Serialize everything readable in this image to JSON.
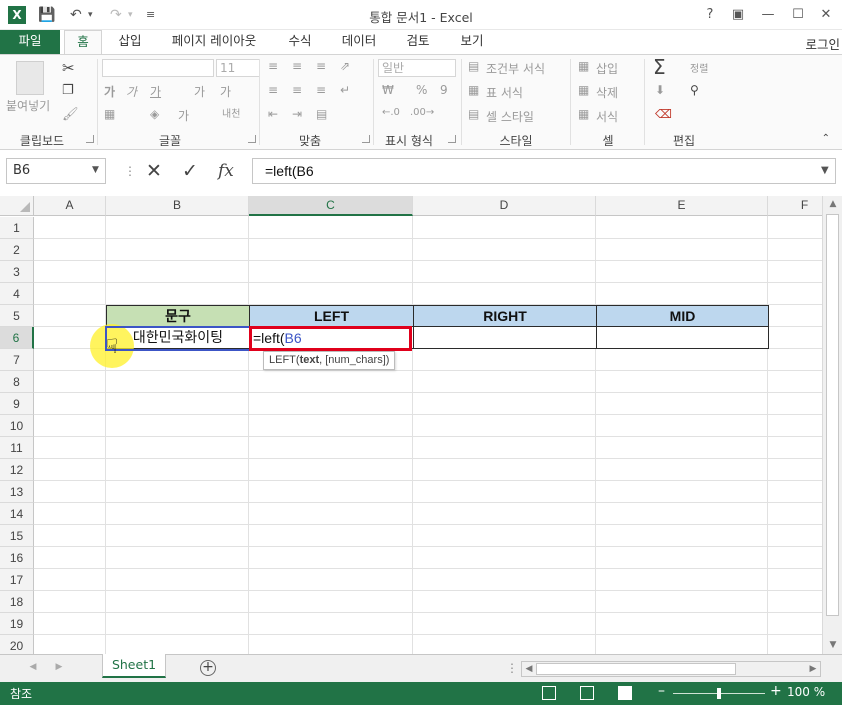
{
  "app": {
    "title": "통합 문서1 - Excel",
    "logo_letter": "X",
    "quick_access": {
      "save_icon": "save-icon",
      "undo_icon": "undo-icon",
      "redo_icon": "redo-icon",
      "customize_icon": "customize-qat-icon"
    },
    "window_buttons": [
      "help",
      "ribbon-display",
      "minimize",
      "maximize",
      "close"
    ]
  },
  "tabs": [
    {
      "label": "파일",
      "kind": "file"
    },
    {
      "label": "홈",
      "kind": "active"
    },
    {
      "label": "삽입"
    },
    {
      "label": "페이지 레이아웃"
    },
    {
      "label": "수식"
    },
    {
      "label": "데이터"
    },
    {
      "label": "검토"
    },
    {
      "label": "보기"
    }
  ],
  "account": {
    "label": "로그인"
  },
  "ribbon": {
    "groups": {
      "clipboard": {
        "label": "클립보드",
        "paste": "붙여넣기"
      },
      "font": {
        "label": "글꼴",
        "font_size": "11",
        "bold": "가",
        "italic": "가",
        "underline": "가",
        "grow": "가",
        "shrink": "가",
        "phonetic": "내천"
      },
      "alignment": {
        "label": "맞춤"
      },
      "number": {
        "label": "표시 형식",
        "format": "일반",
        "currency": "₩",
        "percent": "%",
        "comma": "9"
      },
      "styles": {
        "label": "스타일",
        "conditional": "조건부 서식",
        "table": "표 서식",
        "cell": "셀 스타일"
      },
      "cells": {
        "label": "셀",
        "insert": "삽입",
        "delete": "삭제",
        "format": "서식"
      },
      "editing": {
        "label": "편집",
        "sort": "정렬"
      }
    }
  },
  "formula_bar": {
    "name_box": "B6",
    "cancel_icon": "cancel-icon",
    "enter_icon": "checkmark-icon",
    "fx_label": "fx",
    "formula": "=left(B6"
  },
  "grid": {
    "columns": [
      "A",
      "B",
      "C",
      "D",
      "E",
      "F"
    ],
    "rows": [
      "1",
      "2",
      "3",
      "4",
      "5",
      "6",
      "7",
      "8",
      "9",
      "10",
      "11",
      "12",
      "13",
      "14",
      "15",
      "16",
      "17",
      "18",
      "19",
      "20"
    ],
    "selected_column": "C",
    "selected_row": "6",
    "header_cells": {
      "B5": "문구",
      "C5": "LEFT",
      "D5": "RIGHT",
      "E5": "MID"
    },
    "data_cells": {
      "B6": "대한민국화이팅"
    },
    "editing_cell": {
      "address": "C6",
      "text_prefix": "=left(",
      "text_ref": "B6"
    },
    "tooltip": {
      "fn": "LEFT(",
      "arg_bold": "text",
      "rest": ", [num_chars])"
    },
    "colors": {
      "header_green": "#c6e0b4",
      "header_blue": "#bdd7ee",
      "ref_blue": "#3c55c6",
      "edit_red": "#e0001b"
    }
  },
  "sheets": [
    {
      "label": "Sheet1",
      "active": true
    }
  ],
  "status": {
    "mode": "참조",
    "zoom": "100 %"
  }
}
